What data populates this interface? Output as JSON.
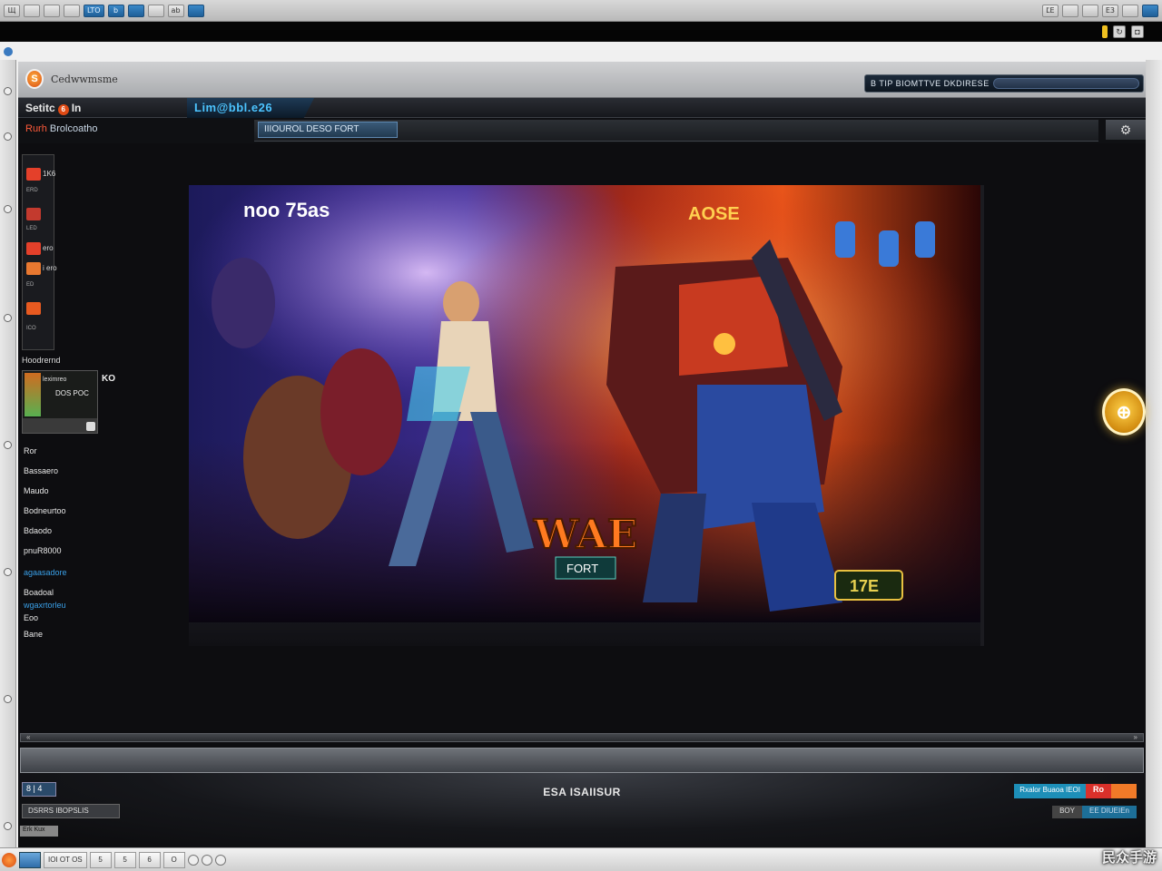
{
  "os_top": {
    "left_buttons": [
      "Щ",
      "",
      "",
      "",
      "LTO",
      "b",
      "",
      "",
      "ab",
      ""
    ],
    "right_buttons": [
      "ĽE",
      "",
      "",
      "E3",
      "",
      ""
    ]
  },
  "window": {
    "title": ""
  },
  "app": {
    "name": "Cedwwmsme",
    "logo_letter": "S",
    "search_label": "B TIP BIOMTTVE DKDIRESE"
  },
  "nav": {
    "section_title": "Setitc",
    "section_suffix": "In",
    "active_tab": "Lim@bbl.e26",
    "breadcrumb_a": "Rurh",
    "breadcrumb_b": "Brolcoatho",
    "search_tab": "IIIOUROL DESO FORT",
    "settings_icon": "⚙"
  },
  "sidebar": {
    "icons": [
      {
        "label": "1K6",
        "color": "#e4402a"
      },
      {
        "label": "",
        "color": "#c33a2e"
      },
      {
        "label": "ero",
        "color": "#e4402a"
      },
      {
        "label": "i ero",
        "color": "#e87830"
      },
      {
        "label": "",
        "color": "#e85a20"
      }
    ],
    "card_title_label": "Hoodrernd",
    "card_line1": "leximreo",
    "card_line2": "DOS POC",
    "card_side": "KO",
    "links": [
      "Ror",
      "Bassaero",
      "Maudo",
      "Bodneurtoo",
      "Bdaodo",
      "pnuR8000",
      "agaasadore",
      "Boadoal",
      "wgaxrtorleu",
      "Eoo",
      "Bane"
    ]
  },
  "hero": {
    "title_left": "noo 75as",
    "title_right": "AOSE",
    "logo_text": "WAE",
    "logo_sub": "FORT",
    "badge": "17E"
  },
  "footer": {
    "title": "ESA ISAIISUR",
    "mini_btn": "8 | 4",
    "btn_b": "DSRRS IBOPSLIS",
    "btn_t": "Erk Kux",
    "action1": "Rxalor Buaoa  IEOI",
    "action2": "Ro",
    "action3_b1": "BOY",
    "action3_b2": "EE DIUEIEn"
  },
  "taskbar": {
    "tasks": [
      "",
      "IOI OT OS",
      "5",
      "5",
      "6",
      "O"
    ]
  },
  "watermark": "民众手游",
  "colors": {
    "accent": "#4cc4ff",
    "brand": "#e04a14",
    "fab": "#ffd24a"
  }
}
